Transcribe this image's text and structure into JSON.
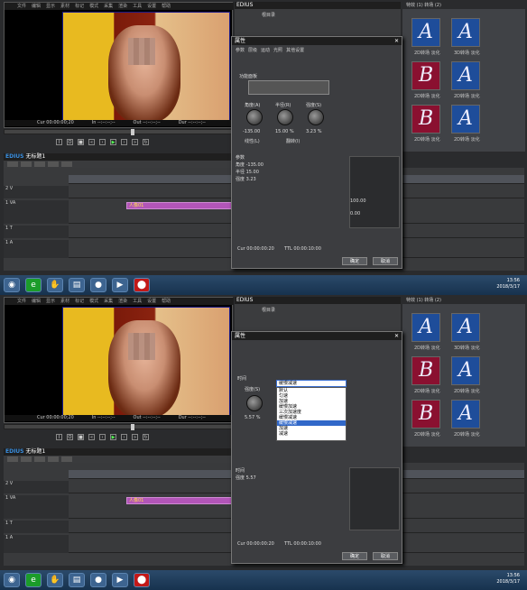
{
  "app": {
    "name": "EDIUS"
  },
  "player": {
    "menu": [
      "文件",
      "编辑",
      "显示",
      "素材",
      "标记",
      "模式",
      "采集",
      "渲染",
      "工具",
      "设置",
      "帮助"
    ],
    "timecode_cur": "Cur 00:00:00;20",
    "timecode_in": "In --:--:--;--",
    "timecode_out": "Out --:--:--;--",
    "timecode_dur": "Dur --:--:--;--",
    "timecode_ttl": "Ttl 00:00:10;00",
    "mode_label": "PLR"
  },
  "timeline": {
    "project_title": "无标题1",
    "ruler_start": "00:00:00:00",
    "ruler_marks": [
      "00:00:05;00",
      "00:00:10;00",
      "00:00:15;00",
      "00:00:20;00"
    ],
    "track_2v": "2 V",
    "track_1va": "1 VA",
    "track_1t": "1 T",
    "track_1a": "1 A",
    "clip_label": "人像01",
    "zoom": "1 0 1S"
  },
  "dialog1": {
    "title": "属性",
    "tabs": [
      "参数",
      "层级",
      "运动",
      "光照",
      "其他设置"
    ],
    "section": "功能面板",
    "angle_label": "角度(A)",
    "radius_label": "半径(R)",
    "strength_label": "强度(S)",
    "angle_value": "-135.00",
    "radius_value": "15.00 %",
    "strength_value": "3.23 %",
    "checkbox_linear": "线性(L)",
    "checkbox_flip": "翻转(I)",
    "tree": [
      "参数",
      "角度 -135.00",
      "半径 15.00",
      "强度 3.23"
    ],
    "graph_max": "100.00",
    "graph_min": "0.00",
    "cur": "Cur 00:00:00:20",
    "ttl": "TTL 00:00:10:00",
    "ok": "确定",
    "cancel": "取消"
  },
  "dialog2": {
    "title": "属性",
    "section": "时间",
    "strength_label": "强度(S)",
    "strength_value": "5.57 %",
    "mode_label": "模式",
    "dropdown_value": "缓慢减速",
    "dropdown_items": [
      "默认",
      "匀速",
      "加速",
      "缓慢加速",
      "三次加速度",
      "缓慢减速",
      "缓慢减速",
      "加速",
      "减速"
    ],
    "selected_index": 6,
    "tree": [
      "时间",
      "强度 5.57"
    ],
    "cur": "Cur 00:00:00:20",
    "ttl": "TTL 00:00:10:00",
    "ok": "确定",
    "cancel": "取消"
  },
  "bin": {
    "title": "EDIUS",
    "folder": "根目录"
  },
  "fx": {
    "header": "特效 (1) 转场 (2)",
    "tiles": [
      {
        "letter": "A",
        "caption": "2D转场 淡化",
        "color": "#1e4d9a"
      },
      {
        "letter": "A",
        "caption": "3D转场 淡化",
        "color": "#1e4d9a"
      },
      {
        "letter": "B",
        "caption": "2D转场 淡化",
        "color": "#8a1030"
      },
      {
        "letter": "A",
        "caption": "2D转场 淡化",
        "color": "#1e4d9a"
      },
      {
        "letter": "B",
        "caption": "2D转场 淡化",
        "color": "#8a1030"
      },
      {
        "letter": "A",
        "caption": "2D转场 淡化",
        "color": "#1e4d9a"
      }
    ]
  },
  "taskbar": {
    "time": "13:56",
    "date": "2018/3/17"
  }
}
